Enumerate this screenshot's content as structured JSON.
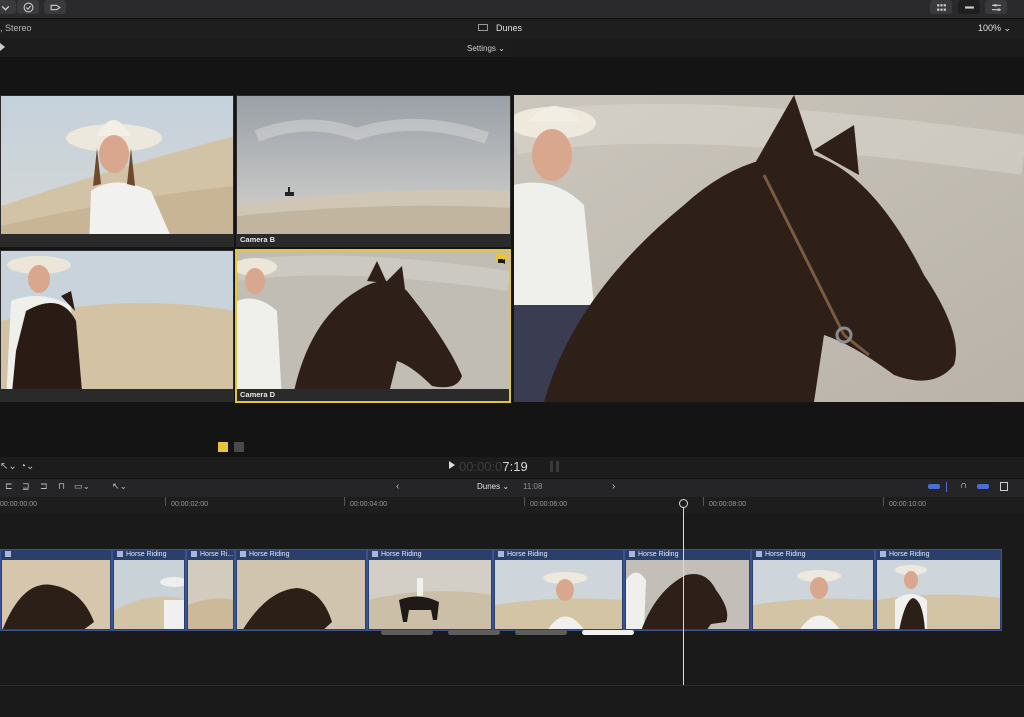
{
  "info": {
    "audio_format": ", Stereo",
    "project_name": "Dunes",
    "zoom": "100%"
  },
  "angle_viewer": {
    "settings_label": "Settings",
    "angles": [
      {
        "label": ""
      },
      {
        "label": "Camera B"
      },
      {
        "label": ""
      },
      {
        "label": "Camera D"
      }
    ]
  },
  "timecode": {
    "dim": "00:00:0",
    "bright": "7:19"
  },
  "timeline": {
    "project_name": "Dunes",
    "duration": "11:08",
    "ruler": [
      "00:00:00:00",
      "00:00:02:00",
      "00:00:04:00",
      "00:00:06:00",
      "00:00:08:00",
      "00:00:10:00"
    ],
    "clips": [
      {
        "title": ""
      },
      {
        "title": "Horse Riding"
      },
      {
        "title": "Horse Ri..."
      },
      {
        "title": "Horse Riding"
      },
      {
        "title": "Horse Riding"
      },
      {
        "title": "Horse Riding"
      },
      {
        "title": "Horse Riding"
      },
      {
        "title": "Horse Riding"
      },
      {
        "title": "Horse Riding"
      }
    ]
  },
  "colors": {
    "accent_yellow": "#e4c53c",
    "clip_blue": "#2b3f6c",
    "audio_blue": "#4a6fd3"
  }
}
